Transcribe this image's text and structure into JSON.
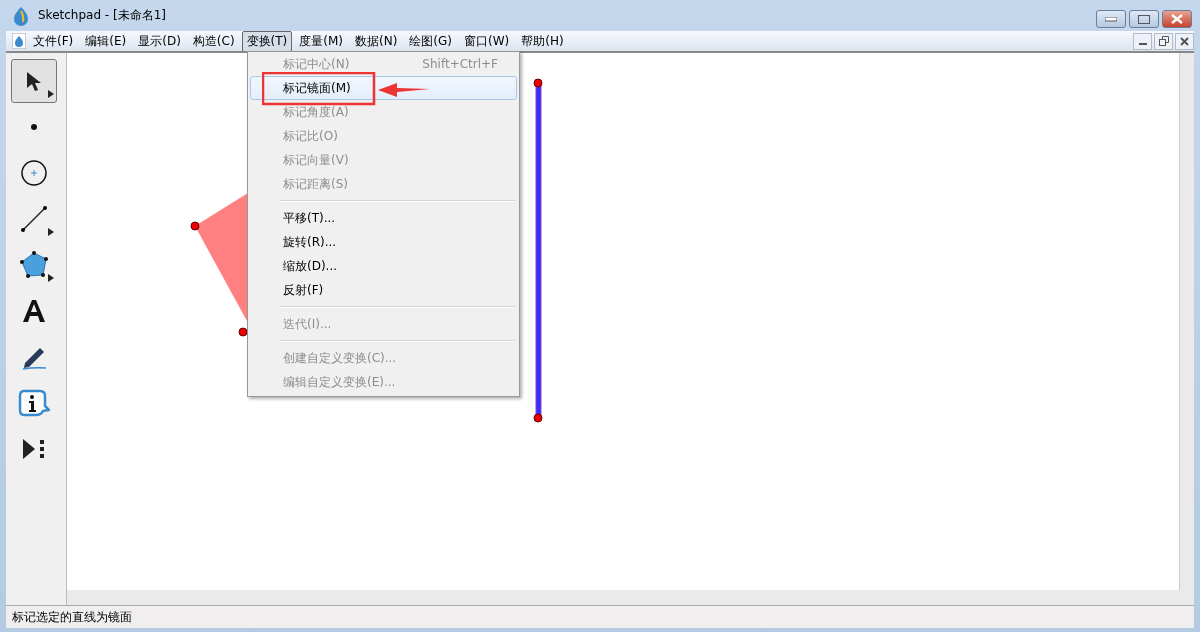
{
  "window": {
    "title": "Sketchpad  - [未命名1]"
  },
  "menu_bar": [
    {
      "label": "文件(F)",
      "selected": false
    },
    {
      "label": "编辑(E)",
      "selected": false
    },
    {
      "label": "显示(D)",
      "selected": false
    },
    {
      "label": "构造(C)",
      "selected": false
    },
    {
      "label": "变换(T)",
      "selected": true
    },
    {
      "label": "度量(M)",
      "selected": false
    },
    {
      "label": "数据(N)",
      "selected": false
    },
    {
      "label": "绘图(G)",
      "selected": false
    },
    {
      "label": "窗口(W)",
      "selected": false
    },
    {
      "label": "帮助(H)",
      "selected": false
    }
  ],
  "tools": [
    {
      "kind": "arrow",
      "selected": true
    },
    {
      "kind": "point",
      "selected": false
    },
    {
      "kind": "compass",
      "selected": false
    },
    {
      "kind": "line",
      "selected": false
    },
    {
      "kind": "polygon",
      "selected": false
    },
    {
      "kind": "text",
      "selected": false
    },
    {
      "kind": "marker",
      "selected": false
    },
    {
      "kind": "info",
      "selected": false
    },
    {
      "kind": "custom",
      "selected": false
    }
  ],
  "dropdown_menu": {
    "groups": [
      [
        {
          "label": "标记中心(N)",
          "shortcut": "Shift+Ctrl+F",
          "disabled": true,
          "selected": false
        },
        {
          "label": "标记镜面(M)",
          "disabled": false,
          "selected": true
        },
        {
          "label": "标记角度(A)",
          "disabled": true,
          "selected": false
        },
        {
          "label": "标记比(O)",
          "disabled": true,
          "selected": false
        },
        {
          "label": "标记向量(V)",
          "disabled": true,
          "selected": false
        },
        {
          "label": "标记距离(S)",
          "disabled": true,
          "selected": false
        }
      ],
      [
        {
          "label": "平移(T)...",
          "disabled": false,
          "selected": false
        },
        {
          "label": "旋转(R)...",
          "disabled": false,
          "selected": false
        },
        {
          "label": "缩放(D)...",
          "disabled": false,
          "selected": false
        },
        {
          "label": "反射(F)",
          "disabled": false,
          "selected": false
        }
      ],
      [
        {
          "label": "迭代(I)...",
          "disabled": true,
          "selected": false
        }
      ],
      [
        {
          "label": "创建自定义变换(C)...",
          "disabled": true,
          "selected": false
        },
        {
          "label": "编辑自定义变换(E)...",
          "disabled": true,
          "selected": false
        }
      ]
    ]
  },
  "status_bar": {
    "text": "标记选定的直线为镜面"
  }
}
